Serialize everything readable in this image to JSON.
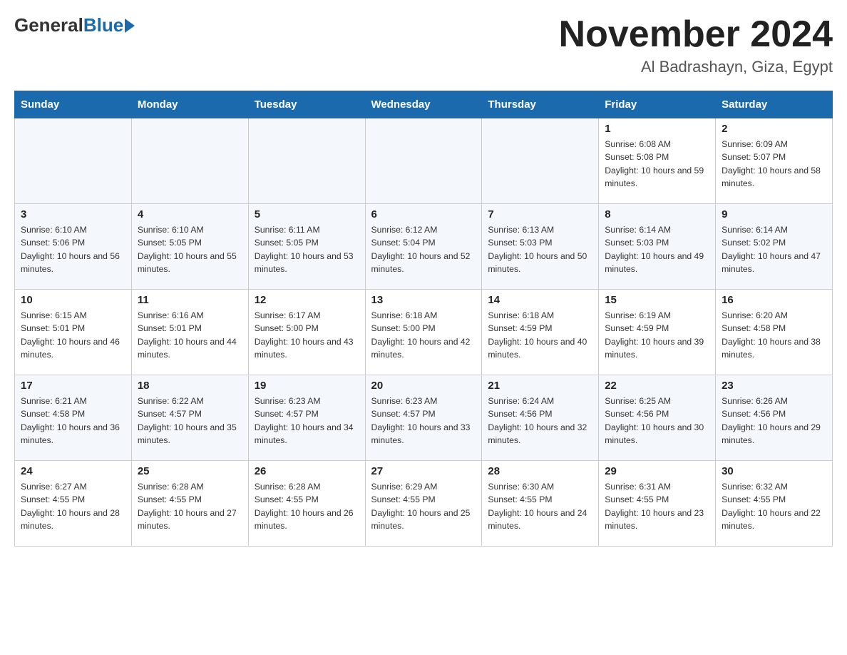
{
  "header": {
    "logo_general": "General",
    "logo_blue": "Blue",
    "title": "November 2024",
    "subtitle": "Al Badrashayn, Giza, Egypt"
  },
  "weekdays": [
    "Sunday",
    "Monday",
    "Tuesday",
    "Wednesday",
    "Thursday",
    "Friday",
    "Saturday"
  ],
  "weeks": [
    [
      {
        "day": "",
        "sunrise": "",
        "sunset": "",
        "daylight": ""
      },
      {
        "day": "",
        "sunrise": "",
        "sunset": "",
        "daylight": ""
      },
      {
        "day": "",
        "sunrise": "",
        "sunset": "",
        "daylight": ""
      },
      {
        "day": "",
        "sunrise": "",
        "sunset": "",
        "daylight": ""
      },
      {
        "day": "",
        "sunrise": "",
        "sunset": "",
        "daylight": ""
      },
      {
        "day": "1",
        "sunrise": "Sunrise: 6:08 AM",
        "sunset": "Sunset: 5:08 PM",
        "daylight": "Daylight: 10 hours and 59 minutes."
      },
      {
        "day": "2",
        "sunrise": "Sunrise: 6:09 AM",
        "sunset": "Sunset: 5:07 PM",
        "daylight": "Daylight: 10 hours and 58 minutes."
      }
    ],
    [
      {
        "day": "3",
        "sunrise": "Sunrise: 6:10 AM",
        "sunset": "Sunset: 5:06 PM",
        "daylight": "Daylight: 10 hours and 56 minutes."
      },
      {
        "day": "4",
        "sunrise": "Sunrise: 6:10 AM",
        "sunset": "Sunset: 5:05 PM",
        "daylight": "Daylight: 10 hours and 55 minutes."
      },
      {
        "day": "5",
        "sunrise": "Sunrise: 6:11 AM",
        "sunset": "Sunset: 5:05 PM",
        "daylight": "Daylight: 10 hours and 53 minutes."
      },
      {
        "day": "6",
        "sunrise": "Sunrise: 6:12 AM",
        "sunset": "Sunset: 5:04 PM",
        "daylight": "Daylight: 10 hours and 52 minutes."
      },
      {
        "day": "7",
        "sunrise": "Sunrise: 6:13 AM",
        "sunset": "Sunset: 5:03 PM",
        "daylight": "Daylight: 10 hours and 50 minutes."
      },
      {
        "day": "8",
        "sunrise": "Sunrise: 6:14 AM",
        "sunset": "Sunset: 5:03 PM",
        "daylight": "Daylight: 10 hours and 49 minutes."
      },
      {
        "day": "9",
        "sunrise": "Sunrise: 6:14 AM",
        "sunset": "Sunset: 5:02 PM",
        "daylight": "Daylight: 10 hours and 47 minutes."
      }
    ],
    [
      {
        "day": "10",
        "sunrise": "Sunrise: 6:15 AM",
        "sunset": "Sunset: 5:01 PM",
        "daylight": "Daylight: 10 hours and 46 minutes."
      },
      {
        "day": "11",
        "sunrise": "Sunrise: 6:16 AM",
        "sunset": "Sunset: 5:01 PM",
        "daylight": "Daylight: 10 hours and 44 minutes."
      },
      {
        "day": "12",
        "sunrise": "Sunrise: 6:17 AM",
        "sunset": "Sunset: 5:00 PM",
        "daylight": "Daylight: 10 hours and 43 minutes."
      },
      {
        "day": "13",
        "sunrise": "Sunrise: 6:18 AM",
        "sunset": "Sunset: 5:00 PM",
        "daylight": "Daylight: 10 hours and 42 minutes."
      },
      {
        "day": "14",
        "sunrise": "Sunrise: 6:18 AM",
        "sunset": "Sunset: 4:59 PM",
        "daylight": "Daylight: 10 hours and 40 minutes."
      },
      {
        "day": "15",
        "sunrise": "Sunrise: 6:19 AM",
        "sunset": "Sunset: 4:59 PM",
        "daylight": "Daylight: 10 hours and 39 minutes."
      },
      {
        "day": "16",
        "sunrise": "Sunrise: 6:20 AM",
        "sunset": "Sunset: 4:58 PM",
        "daylight": "Daylight: 10 hours and 38 minutes."
      }
    ],
    [
      {
        "day": "17",
        "sunrise": "Sunrise: 6:21 AM",
        "sunset": "Sunset: 4:58 PM",
        "daylight": "Daylight: 10 hours and 36 minutes."
      },
      {
        "day": "18",
        "sunrise": "Sunrise: 6:22 AM",
        "sunset": "Sunset: 4:57 PM",
        "daylight": "Daylight: 10 hours and 35 minutes."
      },
      {
        "day": "19",
        "sunrise": "Sunrise: 6:23 AM",
        "sunset": "Sunset: 4:57 PM",
        "daylight": "Daylight: 10 hours and 34 minutes."
      },
      {
        "day": "20",
        "sunrise": "Sunrise: 6:23 AM",
        "sunset": "Sunset: 4:57 PM",
        "daylight": "Daylight: 10 hours and 33 minutes."
      },
      {
        "day": "21",
        "sunrise": "Sunrise: 6:24 AM",
        "sunset": "Sunset: 4:56 PM",
        "daylight": "Daylight: 10 hours and 32 minutes."
      },
      {
        "day": "22",
        "sunrise": "Sunrise: 6:25 AM",
        "sunset": "Sunset: 4:56 PM",
        "daylight": "Daylight: 10 hours and 30 minutes."
      },
      {
        "day": "23",
        "sunrise": "Sunrise: 6:26 AM",
        "sunset": "Sunset: 4:56 PM",
        "daylight": "Daylight: 10 hours and 29 minutes."
      }
    ],
    [
      {
        "day": "24",
        "sunrise": "Sunrise: 6:27 AM",
        "sunset": "Sunset: 4:55 PM",
        "daylight": "Daylight: 10 hours and 28 minutes."
      },
      {
        "day": "25",
        "sunrise": "Sunrise: 6:28 AM",
        "sunset": "Sunset: 4:55 PM",
        "daylight": "Daylight: 10 hours and 27 minutes."
      },
      {
        "day": "26",
        "sunrise": "Sunrise: 6:28 AM",
        "sunset": "Sunset: 4:55 PM",
        "daylight": "Daylight: 10 hours and 26 minutes."
      },
      {
        "day": "27",
        "sunrise": "Sunrise: 6:29 AM",
        "sunset": "Sunset: 4:55 PM",
        "daylight": "Daylight: 10 hours and 25 minutes."
      },
      {
        "day": "28",
        "sunrise": "Sunrise: 6:30 AM",
        "sunset": "Sunset: 4:55 PM",
        "daylight": "Daylight: 10 hours and 24 minutes."
      },
      {
        "day": "29",
        "sunrise": "Sunrise: 6:31 AM",
        "sunset": "Sunset: 4:55 PM",
        "daylight": "Daylight: 10 hours and 23 minutes."
      },
      {
        "day": "30",
        "sunrise": "Sunrise: 6:32 AM",
        "sunset": "Sunset: 4:55 PM",
        "daylight": "Daylight: 10 hours and 22 minutes."
      }
    ]
  ]
}
